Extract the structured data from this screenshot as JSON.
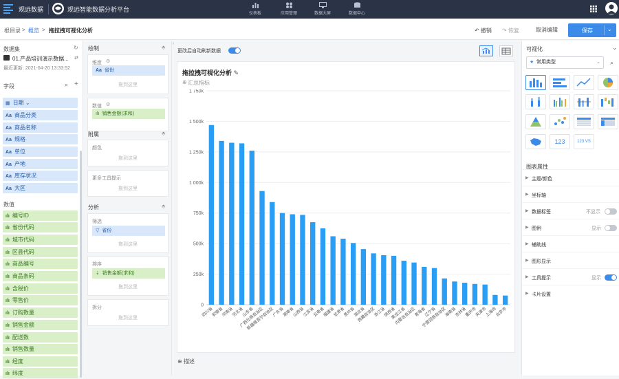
{
  "app": {
    "name": "观远数据",
    "platform_title": "观远智能数据分析平台"
  },
  "nav": [
    {
      "label": "仪表板",
      "icon": "dashboard-icon"
    },
    {
      "label": "应用管理",
      "icon": "apps-icon"
    },
    {
      "label": "数据大屏",
      "icon": "screen-icon"
    },
    {
      "label": "数据中心",
      "icon": "data-center-icon"
    }
  ],
  "breadcrumb": {
    "root": "根目录",
    "sep": ">",
    "parent": "概览",
    "current": "拖拉拽可视化分析"
  },
  "toolbar": {
    "undo": "撤销",
    "redo": "恢复",
    "cancel_edit": "取消编辑",
    "save": "保存"
  },
  "left": {
    "dataset_label": "数据集",
    "dataset_name": "01.产品培训演示数据...",
    "last_update": "最近更新: 2021-04-20 13:33:52",
    "fields_label": "字段",
    "dimensions": [
      "日期",
      "商品分类",
      "商品名称",
      "规格",
      "单位",
      "产地",
      "库存状况",
      "大区"
    ],
    "measures_label": "数值",
    "measures": [
      "编号ID",
      "省份代码",
      "城市代码",
      "区县代码",
      "商品编号",
      "商品条码",
      "含税价",
      "零售价",
      "订购数量",
      "销售金额",
      "配送数",
      "销售数量",
      "经度",
      "纬度"
    ]
  },
  "mid": {
    "draw_label": "绘制",
    "dimension_label": "维度",
    "dimension_chip": "省份",
    "value_label": "数值",
    "value_chip": "销售金额(求和)",
    "drop_hint": "拖到这里",
    "attach_label": "附属",
    "color_label": "颜色",
    "tooltip_label": "更多工具提示",
    "analysis_label": "分析",
    "filter_label": "筛选",
    "filter_chip": "省份",
    "sort_label": "排序",
    "sort_chip": "销售金额(求和)",
    "split_label": "拆分"
  },
  "canvas": {
    "auto_refresh": "更改后自动刷新数据",
    "chart_title": "拖拉拽可视化分析",
    "summary": "汇总指标",
    "description": "描述"
  },
  "chart_data": {
    "type": "bar",
    "categories": [
      "四川省",
      "安徽省",
      "河南省",
      "河北省",
      "山东省",
      "广西壮族自治区",
      "新疆维吾尔自治区",
      "广东省",
      "湖南省",
      "山西省",
      "江苏省",
      "云南省",
      "福建省",
      "甘肃省",
      "贵州省",
      "湖北省",
      "西藏自治区",
      "浙江省",
      "陕西省",
      "黑龙江省",
      "内蒙古自治区",
      "青海省",
      "辽宁省",
      "宁夏回族自治区",
      "海南省",
      "吉林省",
      "重庆市",
      "天津市",
      "上海市",
      "北京市"
    ],
    "values": [
      1470000,
      1340000,
      1325000,
      1320000,
      1260000,
      930000,
      840000,
      750000,
      740000,
      735000,
      675000,
      625000,
      560000,
      540000,
      505000,
      455000,
      420000,
      405000,
      400000,
      360000,
      345000,
      310000,
      300000,
      215000,
      190000,
      180000,
      170000,
      165000,
      80000,
      75000
    ],
    "ylim": [
      0,
      1750000
    ],
    "yticks": [
      "0",
      "250k",
      "500k",
      "750k",
      "1 000k",
      "1 250k",
      "1 500k",
      "1 750k"
    ],
    "color": "#2a9df4",
    "grid": true
  },
  "right": {
    "header": "可视化",
    "chart_type_select": "常用类型",
    "chart_props_label": "图表属性",
    "props": [
      {
        "name": "主题/颜色"
      },
      {
        "name": "坐标轴"
      },
      {
        "name": "数据标签",
        "value": "不显示",
        "toggle": false
      },
      {
        "name": "图例",
        "value": "显示",
        "toggle": false
      },
      {
        "name": "辅助线"
      },
      {
        "name": "图形显示"
      },
      {
        "name": "工具提示",
        "value": "显示",
        "toggle": true
      },
      {
        "name": "卡片设置"
      }
    ],
    "thumb_labels": {
      "number": "123",
      "compare": "123 VS"
    }
  },
  "colors": {
    "accent": "#3d8be8",
    "topbar": "#2b3346",
    "bar": "#2a9df4"
  }
}
